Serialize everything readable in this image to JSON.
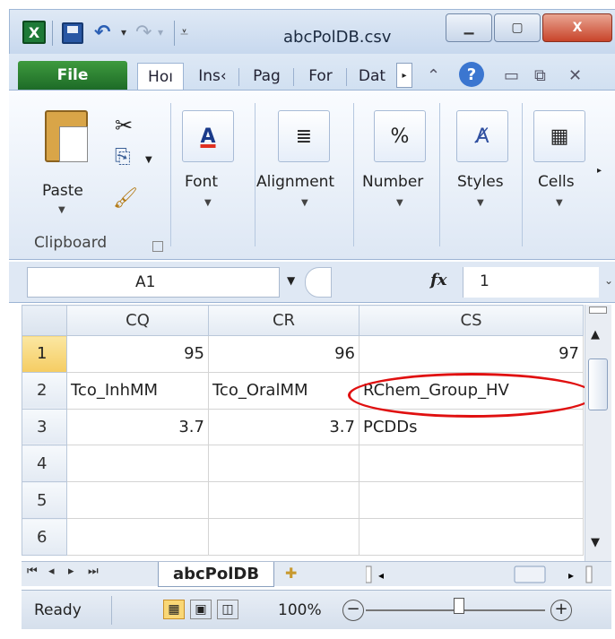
{
  "window": {
    "title": "abcPolDB.csv",
    "app_icon": "X",
    "close": "X"
  },
  "tabs": {
    "file": "File",
    "home": "Hoı",
    "insert": "Ins‹",
    "page": "Pag",
    "formulas": "For",
    "data": "Dat"
  },
  "ribbon": {
    "paste": "Paste",
    "clipboard": "Clipboard",
    "font": "Font",
    "font_glyph": "A",
    "alignment": "Alignment",
    "number": "Number",
    "number_glyph": "%",
    "styles": "Styles",
    "cells": "Cells"
  },
  "formula_bar": {
    "name_box": "A1",
    "fx": "fx",
    "value": "1"
  },
  "grid": {
    "columns": [
      "CQ",
      "CR",
      "CS"
    ],
    "rows": [
      {
        "num": "1",
        "cells": [
          "95",
          "96",
          "97"
        ]
      },
      {
        "num": "2",
        "cells": [
          "Tco_InhMM",
          "Tco_OralMM",
          "RChem_Group_HV"
        ]
      },
      {
        "num": "3",
        "cells": [
          "3.7",
          "3.7",
          "PCDDs"
        ]
      },
      {
        "num": "4",
        "cells": [
          "",
          "",
          ""
        ]
      },
      {
        "num": "5",
        "cells": [
          "",
          "",
          ""
        ]
      },
      {
        "num": "6",
        "cells": [
          "",
          "",
          ""
        ]
      }
    ],
    "selected_row": "1"
  },
  "sheet": {
    "active": "abcPolDB"
  },
  "status": {
    "ready": "Ready",
    "zoom": "100%"
  },
  "icons": [
    "excel-icon",
    "save-icon",
    "undo-icon",
    "redo-icon",
    "help-icon",
    "cut-icon",
    "copy-icon",
    "format-painter-icon"
  ],
  "colors": {
    "file_tab": "#1d6b27",
    "highlight_ellipse": "#e01010",
    "selected_row_header": "#f5cc62"
  }
}
